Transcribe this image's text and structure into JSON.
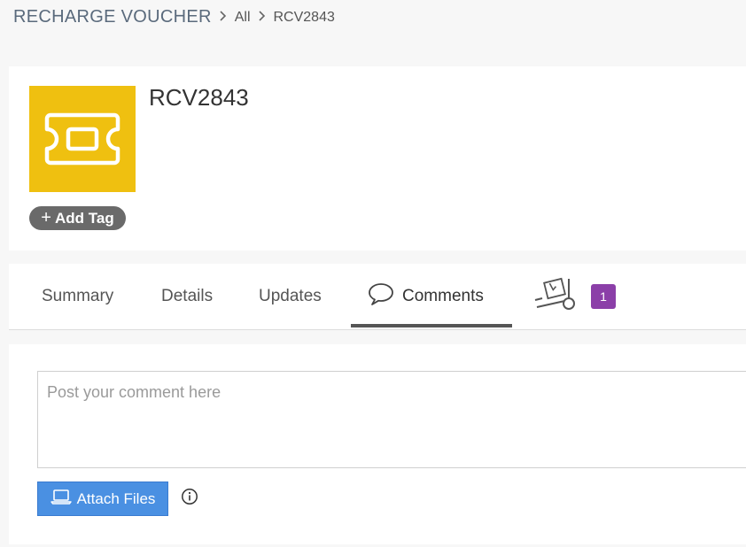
{
  "breadcrumb": {
    "module": "RECHARGE VOUCHER",
    "separator": ">",
    "items": [
      "All",
      "RCV2843"
    ]
  },
  "record": {
    "title": "RCV2843",
    "icon": "voucher-ticket-icon",
    "icon_bg": "#efc010",
    "add_tag_label": "Add Tag"
  },
  "tabs": [
    {
      "label": "Summary",
      "active": false
    },
    {
      "label": "Details",
      "active": false
    },
    {
      "label": "Updates",
      "active": false
    },
    {
      "label": "Comments",
      "active": true,
      "icon": "speech-bubble-icon"
    },
    {
      "label": "",
      "icon": "hand-truck-icon",
      "badge": "1"
    }
  ],
  "comments": {
    "placeholder": "Post your comment here",
    "value": "",
    "attach_label": "Attach Files",
    "info_icon": "info-icon"
  },
  "colors": {
    "accent": "#4a90e2",
    "badge": "#8b3fa8",
    "tag": "#6a6a6a"
  }
}
